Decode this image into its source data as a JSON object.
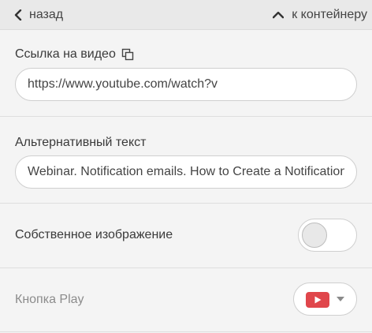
{
  "topbar": {
    "back_label": "назад",
    "container_label": "к контейнеру"
  },
  "video_link": {
    "label": "Ссылка на видео",
    "value": "https://www.youtube.com/watch?v"
  },
  "alt_text": {
    "label": "Альтернативный текст",
    "value": "Webinar. Notification emails. How to Create a Notification Email"
  },
  "own_image": {
    "label": "Собственное изображение",
    "enabled": false
  },
  "play_button": {
    "label": "Кнопка Play",
    "selected_icon": "youtube-play-icon"
  },
  "colors": {
    "youtube_red": "#e0464b",
    "panel_bg": "#f4f4f4",
    "topbar_bg": "#e9e9e9"
  }
}
